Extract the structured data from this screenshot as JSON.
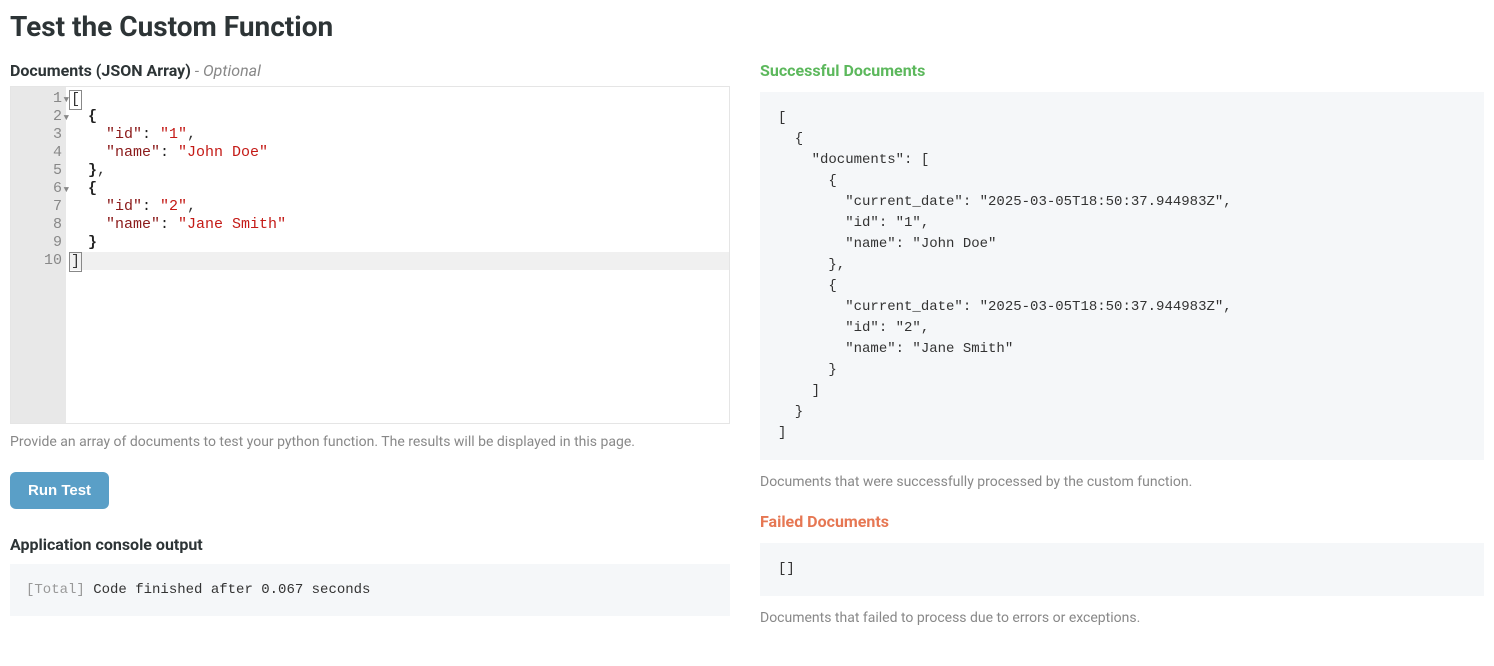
{
  "title": "Test the Custom Function",
  "left": {
    "documents_label": "Documents (JSON Array)",
    "optional": " - Optional",
    "editor": {
      "gutter": [
        {
          "n": "1",
          "fold": true
        },
        {
          "n": "2",
          "fold": true
        },
        {
          "n": "3",
          "fold": false
        },
        {
          "n": "4",
          "fold": false
        },
        {
          "n": "5",
          "fold": false
        },
        {
          "n": "6",
          "fold": true
        },
        {
          "n": "7",
          "fold": false
        },
        {
          "n": "8",
          "fold": false
        },
        {
          "n": "9",
          "fold": false
        },
        {
          "n": "10",
          "fold": false
        }
      ],
      "lines": [
        {
          "segs": [
            {
              "cls": "cursor-box",
              "t": "["
            }
          ]
        },
        {
          "segs": [
            {
              "cls": "",
              "t": "  "
            },
            {
              "cls": "tok-bracket",
              "t": "{"
            }
          ]
        },
        {
          "segs": [
            {
              "cls": "",
              "t": "    "
            },
            {
              "cls": "tok-key",
              "t": "\"id\""
            },
            {
              "cls": "tok-colon",
              "t": ": "
            },
            {
              "cls": "tok-string",
              "t": "\"1\""
            },
            {
              "cls": "",
              "t": ","
            }
          ]
        },
        {
          "segs": [
            {
              "cls": "",
              "t": "    "
            },
            {
              "cls": "tok-key",
              "t": "\"name\""
            },
            {
              "cls": "tok-colon",
              "t": ": "
            },
            {
              "cls": "tok-string",
              "t": "\"John Doe\""
            }
          ]
        },
        {
          "segs": [
            {
              "cls": "",
              "t": "  "
            },
            {
              "cls": "tok-bracket",
              "t": "}"
            },
            {
              "cls": "",
              "t": ","
            }
          ]
        },
        {
          "segs": [
            {
              "cls": "",
              "t": "  "
            },
            {
              "cls": "tok-bracket",
              "t": "{"
            }
          ]
        },
        {
          "segs": [
            {
              "cls": "",
              "t": "    "
            },
            {
              "cls": "tok-key",
              "t": "\"id\""
            },
            {
              "cls": "tok-colon",
              "t": ": "
            },
            {
              "cls": "tok-string",
              "t": "\"2\""
            },
            {
              "cls": "",
              "t": ","
            }
          ]
        },
        {
          "segs": [
            {
              "cls": "",
              "t": "    "
            },
            {
              "cls": "tok-key",
              "t": "\"name\""
            },
            {
              "cls": "tok-colon",
              "t": ": "
            },
            {
              "cls": "tok-string",
              "t": "\"Jane Smith\""
            }
          ]
        },
        {
          "segs": [
            {
              "cls": "",
              "t": "  "
            },
            {
              "cls": "tok-bracket",
              "t": "}"
            }
          ]
        },
        {
          "segs": [
            {
              "cls": "cursor-box",
              "t": "]"
            }
          ],
          "active": true
        }
      ]
    },
    "help_text": "Provide an array of documents to test your python function. The results will be displayed in this page.",
    "run_button": "Run Test",
    "console_label": "Application console output",
    "console_tag": "[Total]",
    "console_text": " Code finished after 0.067 seconds"
  },
  "right": {
    "success_title": "Successful Documents",
    "success_output": "[\n  {\n    \"documents\": [\n      {\n        \"current_date\": \"2025-03-05T18:50:37.944983Z\",\n        \"id\": \"1\",\n        \"name\": \"John Doe\"\n      },\n      {\n        \"current_date\": \"2025-03-05T18:50:37.944983Z\",\n        \"id\": \"2\",\n        \"name\": \"Jane Smith\"\n      }\n    ]\n  }\n]",
    "success_help": "Documents that were successfully processed by the custom function.",
    "failed_title": "Failed Documents",
    "failed_output": "[]",
    "failed_help": "Documents that failed to process due to errors or exceptions."
  }
}
